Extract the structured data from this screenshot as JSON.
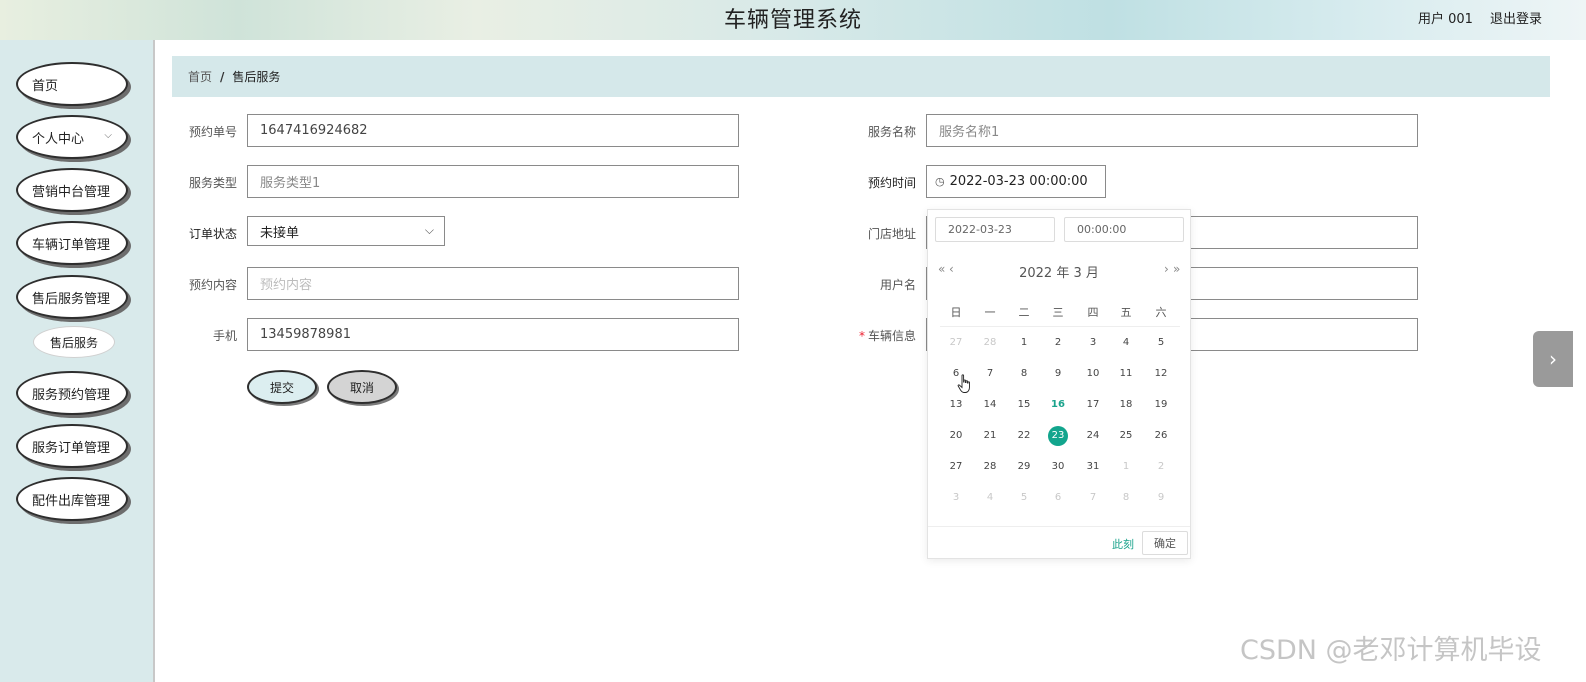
{
  "header": {
    "title": "车辆管理系统",
    "user": "用户 001",
    "logout": "退出登录"
  },
  "sidebar": {
    "items": [
      {
        "label": "首页"
      },
      {
        "label": "个人中心"
      },
      {
        "label": "营销中台管理"
      },
      {
        "label": "车辆订单管理"
      },
      {
        "label": "售后服务管理"
      },
      {
        "label": "服务预约管理"
      },
      {
        "label": "服务订单管理"
      },
      {
        "label": "配件出库管理"
      }
    ],
    "sub_item": "售后服务"
  },
  "breadcrumb": {
    "home": "首页",
    "separator": "/",
    "current": "售后服务"
  },
  "form": {
    "order_no": {
      "label": "预约单号",
      "value": "1647416924682"
    },
    "service_name": {
      "label": "服务名称",
      "value": "服务名称1"
    },
    "service_type": {
      "label": "服务类型",
      "value": "服务类型1"
    },
    "appointment_time": {
      "label": "预约时间",
      "value": "2022-03-23 00:00:00"
    },
    "order_status": {
      "label": "订单状态",
      "value": "未接单"
    },
    "store_address": {
      "label": "门店地址",
      "value": ""
    },
    "content": {
      "label": "预约内容",
      "placeholder": "预约内容"
    },
    "username": {
      "label": "用户名",
      "value": ""
    },
    "phone": {
      "label": "手机",
      "value": "13459878981"
    },
    "vehicle_info": {
      "label": "车辆信息",
      "required": "*",
      "value": ""
    },
    "submit": "提交",
    "cancel": "取消"
  },
  "datepicker": {
    "date_input": "2022-03-23",
    "time_input": "00:00:00",
    "year": "2022",
    "year_unit": "年",
    "month": "3",
    "month_unit": "月",
    "prev_year": "«",
    "prev_month": "‹",
    "next_month": "›",
    "next_year": "»",
    "weekdays": [
      "日",
      "一",
      "二",
      "三",
      "四",
      "五",
      "六"
    ],
    "weeks": [
      [
        "27",
        "28",
        "1",
        "2",
        "3",
        "4",
        "5"
      ],
      [
        "6",
        "7",
        "8",
        "9",
        "10",
        "11",
        "12"
      ],
      [
        "13",
        "14",
        "15",
        "16",
        "17",
        "18",
        "19"
      ],
      [
        "20",
        "21",
        "22",
        "23",
        "24",
        "25",
        "26"
      ],
      [
        "27",
        "28",
        "29",
        "30",
        "31",
        "1",
        "2"
      ],
      [
        "3",
        "4",
        "5",
        "6",
        "7",
        "8",
        "9"
      ]
    ],
    "today": "16",
    "selected": "23",
    "now": "此刻",
    "ok": "确定"
  },
  "watermark": "CSDN @老邓计算机毕设",
  "colors": {
    "accent": "#12a58d",
    "sidebar_bg": "#d9eaeb",
    "breadcrumb_bg": "#d5e8ea"
  }
}
